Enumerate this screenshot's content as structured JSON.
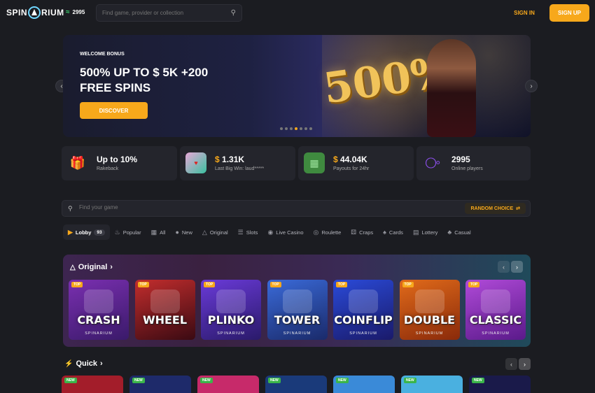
{
  "header": {
    "logo": "SPINARIUM",
    "online_count": "2995",
    "search_placeholder": "Find game, provider or collection",
    "sign_in": "SIGN IN",
    "sign_up": "SIGN UP"
  },
  "banner": {
    "kicker": "WELCOME BONUS",
    "headline": "500% UP TO $ 5K +200 FREE SPINS",
    "cta": "DISCOVER",
    "promo_number": "500",
    "dots_total": 7,
    "active_dot": 3
  },
  "stats": [
    {
      "icon": "gift-icon",
      "value": "Up to 10%",
      "currency": "",
      "label": "Rakeback"
    },
    {
      "icon": "game-thumb-icon",
      "value": "1.31K",
      "currency": "$",
      "label": "Last Big Win: laud*****"
    },
    {
      "icon": "wallet-icon",
      "value": "44.04K",
      "currency": "$",
      "label": "Payouts for 24hr"
    },
    {
      "icon": "wifi-icon",
      "value": "2995",
      "currency": "",
      "label": "Online players"
    }
  ],
  "game_search": {
    "placeholder": "Find your game",
    "random": "RANDOM CHOICE"
  },
  "categories": [
    {
      "icon": "lobby-icon",
      "label": "Lobby",
      "count": "93",
      "active": true
    },
    {
      "icon": "fire-icon",
      "label": "Popular"
    },
    {
      "icon": "all-icon",
      "label": "All"
    },
    {
      "icon": "new-icon",
      "label": "New"
    },
    {
      "icon": "original-icon",
      "label": "Original"
    },
    {
      "icon": "slots-icon",
      "label": "Slots"
    },
    {
      "icon": "live-icon",
      "label": "Live Casino"
    },
    {
      "icon": "roulette-icon",
      "label": "Roulette"
    },
    {
      "icon": "craps-icon",
      "label": "Craps"
    },
    {
      "icon": "cards-icon",
      "label": "Cards"
    },
    {
      "icon": "lottery-icon",
      "label": "Lottery"
    },
    {
      "icon": "casual-icon",
      "label": "Casual"
    }
  ],
  "original": {
    "title": "Original",
    "games": [
      {
        "name": "CRASH",
        "tag": "TOP",
        "brand": "SPINARIUM",
        "colors": [
          "#7a2fb0",
          "#3a1a6a"
        ]
      },
      {
        "name": "WHEEL",
        "tag": "TOP",
        "brand": "",
        "colors": [
          "#c22d2d",
          "#3a0a12"
        ]
      },
      {
        "name": "PLINKO",
        "tag": "TOP",
        "brand": "SPINARIUM",
        "colors": [
          "#6a3ad8",
          "#2a1a6a"
        ]
      },
      {
        "name": "TOWER",
        "tag": "TOP",
        "brand": "SPINARIUM",
        "colors": [
          "#3a6ad8",
          "#1a2a6a"
        ]
      },
      {
        "name": "COINFLIP",
        "tag": "TOP",
        "brand": "SPINARIUM",
        "colors": [
          "#2a4ad8",
          "#1a1a6a"
        ]
      },
      {
        "name": "DOUBLE",
        "tag": "TOP",
        "brand": "SPINARIUM",
        "colors": [
          "#e06a1a",
          "#8a2a0a"
        ]
      },
      {
        "name": "CLASSIC",
        "tag": "TOP",
        "brand": "SPINARIUM",
        "colors": [
          "#b04ad8",
          "#5a1a8a"
        ]
      }
    ]
  },
  "quick": {
    "title": "Quick",
    "tiles": [
      {
        "tag": "NEW",
        "color": "#a31d2a"
      },
      {
        "tag": "NEW",
        "color": "#1e2a6a"
      },
      {
        "tag": "NEW",
        "color": "#c72a6a"
      },
      {
        "tag": "NEW",
        "color": "#1a3a7a"
      },
      {
        "tag": "NEW",
        "color": "#3a8ad8"
      },
      {
        "tag": "NEW",
        "color": "#4ab0e0"
      },
      {
        "tag": "NEW",
        "color": "#1a1a4a"
      }
    ]
  }
}
